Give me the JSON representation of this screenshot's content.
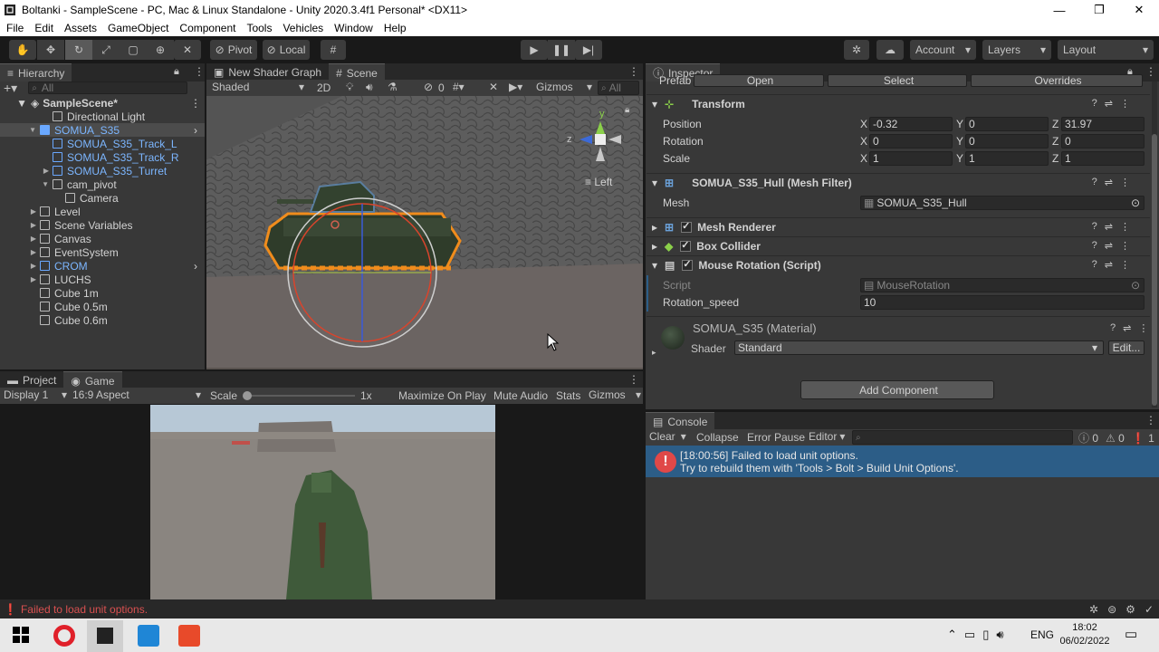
{
  "window": {
    "title": "Boltanki - SampleScene - PC, Mac & Linux Standalone - Unity 2020.3.4f1 Personal* <DX11>",
    "minimize": "—",
    "maximize": "❐",
    "close": "✕"
  },
  "menu": [
    "File",
    "Edit",
    "Assets",
    "GameObject",
    "Component",
    "Tools",
    "Vehicles",
    "Window",
    "Help"
  ],
  "toolbar": {
    "pivot": "Pivot",
    "local": "Local",
    "account": "Account",
    "layers": "Layers",
    "layout": "Layout"
  },
  "hierarchy": {
    "tab": "Hierarchy",
    "search_placeholder": "All",
    "scene": "SampleScene*",
    "items": [
      {
        "label": "Directional Light",
        "indent": 2,
        "color": "normal"
      },
      {
        "label": "SOMUA_S35",
        "indent": 1,
        "color": "blue",
        "selected": true,
        "arrow": "▼"
      },
      {
        "label": "SOMUA_S35_Track_L",
        "indent": 2,
        "color": "blue"
      },
      {
        "label": "SOMUA_S35_Track_R",
        "indent": 2,
        "color": "blue"
      },
      {
        "label": "SOMUA_S35_Turret",
        "indent": 2,
        "color": "blue",
        "arrow": "▶"
      },
      {
        "label": "cam_pivot",
        "indent": 2,
        "color": "normal",
        "arrow": "▼"
      },
      {
        "label": "Camera",
        "indent": 3,
        "color": "normal"
      },
      {
        "label": "Level",
        "indent": 1,
        "color": "normal",
        "arrow": "▶"
      },
      {
        "label": "Scene Variables",
        "indent": 1,
        "color": "normal",
        "arrow": "▶"
      },
      {
        "label": "Canvas",
        "indent": 1,
        "color": "normal",
        "arrow": "▶"
      },
      {
        "label": "EventSystem",
        "indent": 1,
        "color": "normal",
        "arrow": "▶"
      },
      {
        "label": "CROM",
        "indent": 1,
        "color": "blue",
        "arrow": "▶"
      },
      {
        "label": "LUCHS",
        "indent": 1,
        "color": "normal",
        "arrow": "▶"
      },
      {
        "label": "Cube 1m",
        "indent": 1,
        "color": "normal"
      },
      {
        "label": "Cube 0.5m",
        "indent": 1,
        "color": "normal"
      },
      {
        "label": "Cube 0.6m",
        "indent": 1,
        "color": "normal"
      }
    ]
  },
  "scene": {
    "tab_shader": "New Shader Graph",
    "tab_scene": "Scene",
    "shading": "Shaded",
    "mode2d": "2D",
    "hidden_count": "0",
    "gizmos": "Gizmos",
    "search_placeholder": "All",
    "orientation": "Left",
    "axis_x": "x",
    "axis_y": "y",
    "axis_z": "z"
  },
  "game": {
    "tab_project": "Project",
    "tab_game": "Game",
    "display": "Display 1",
    "aspect": "16:9 Aspect",
    "scale_label": "Scale",
    "scale_value": "1x",
    "maximize": "Maximize On Play",
    "mute": "Mute Audio",
    "stats": "Stats",
    "gizmos": "Gizmos"
  },
  "inspector": {
    "tab": "Inspector",
    "prefab": "Prefab",
    "open": "Open",
    "select": "Select",
    "overrides": "Overrides",
    "transform": {
      "title": "Transform",
      "position_label": "Position",
      "rotation_label": "Rotation",
      "scale_label": "Scale",
      "position": {
        "x": "-0.32",
        "y": "0",
        "z": "31.97"
      },
      "rotation": {
        "x": "0",
        "y": "0",
        "z": "0"
      },
      "scale": {
        "x": "1",
        "y": "1",
        "z": "1"
      }
    },
    "mesh_filter": {
      "title": "SOMUA_S35_Hull (Mesh Filter)",
      "mesh_label": "Mesh",
      "mesh_value": "SOMUA_S35_Hull"
    },
    "mesh_renderer": "Mesh Renderer",
    "box_collider": "Box Collider",
    "mouse_rotation": {
      "title": "Mouse Rotation (Script)",
      "script_label": "Script",
      "script_value": "MouseRotation",
      "speed_label": "Rotation_speed",
      "speed_value": "10"
    },
    "material": {
      "title": "SOMUA_S35 (Material)",
      "shader_label": "Shader",
      "shader_value": "Standard",
      "edit": "Edit..."
    },
    "add_component": "Add Component"
  },
  "console": {
    "tab": "Console",
    "clear": "Clear",
    "collapse": "Collapse",
    "error_pause": "Error Pause",
    "editor": "Editor",
    "count_log": "0",
    "count_warn": "0",
    "count_err": "1",
    "message_line1": "[18:00:56] Failed to load unit options.",
    "message_line2": "Try to rebuild them with 'Tools > Bolt > Build Unit Options'."
  },
  "status": {
    "message": "Failed to load unit options."
  },
  "taskbar": {
    "lang": "ENG",
    "time": "18:02",
    "date": "06/02/2022"
  },
  "colors": {
    "accent": "#2c5d87",
    "error": "#ff4646",
    "selection": "#4c4c4c"
  }
}
